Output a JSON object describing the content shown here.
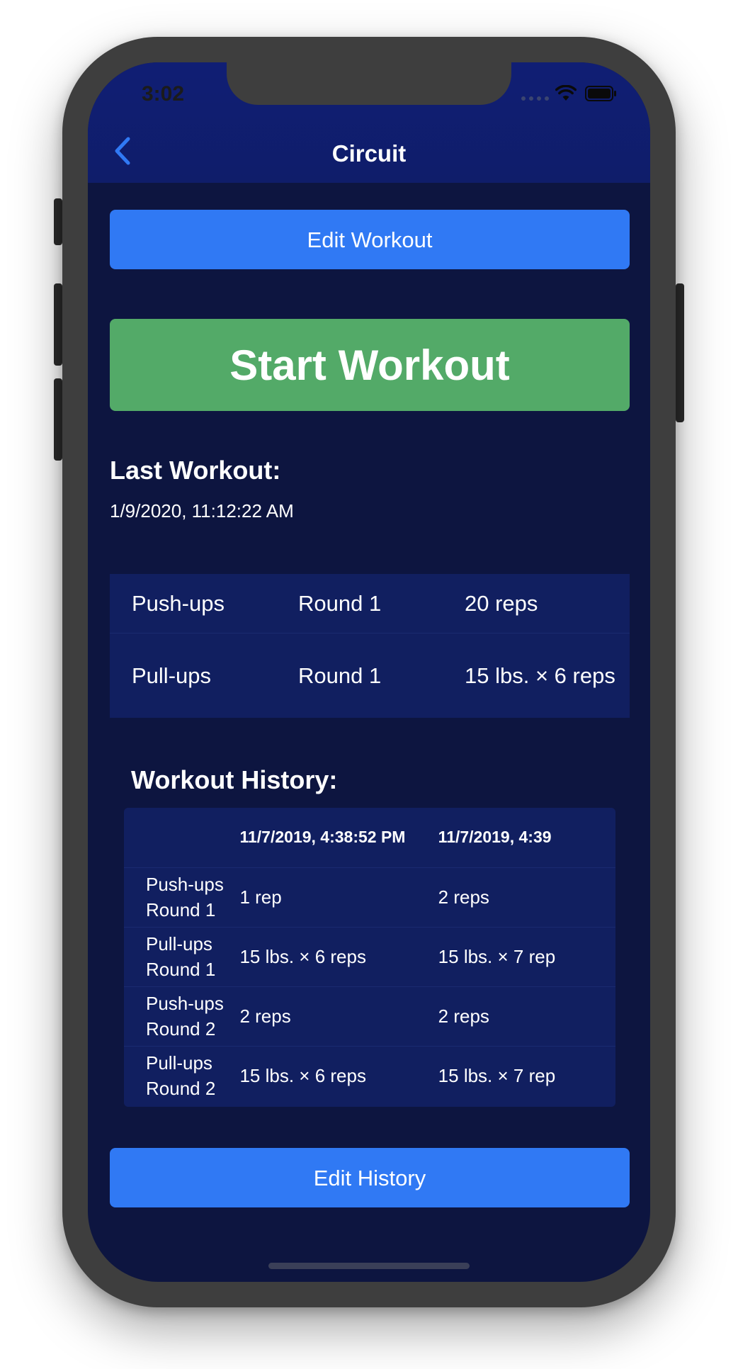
{
  "status_bar": {
    "time": "3:02"
  },
  "nav": {
    "title": "Circuit",
    "back_icon": "chevron-left-icon"
  },
  "buttons": {
    "edit_workout": "Edit Workout",
    "start_workout": "Start Workout",
    "edit_history": "Edit History"
  },
  "last_workout": {
    "heading": "Last Workout:",
    "date": "1/9/2020, 11:12:22 AM",
    "rows": [
      {
        "exercise": "Push-ups",
        "round": "Round 1",
        "result": "20 reps"
      },
      {
        "exercise": "Pull-ups",
        "round": "Round 1",
        "result": "15 lbs. × 6 reps"
      }
    ]
  },
  "history": {
    "heading": "Workout History:",
    "columns": [
      "11/7/2019, 4:38:52 PM",
      "11/7/2019, 4:39"
    ],
    "rows": [
      {
        "exercise": "Push-ups",
        "round": "Round 1",
        "values": [
          "1 rep",
          "2 reps"
        ]
      },
      {
        "exercise": "Pull-ups",
        "round": "Round 1",
        "values": [
          "15 lbs. × 6 reps",
          "15 lbs. × 7 rep"
        ]
      },
      {
        "exercise": "Push-ups",
        "round": "Round 2",
        "values": [
          "2 reps",
          "2 reps"
        ]
      },
      {
        "exercise": "Pull-ups",
        "round": "Round 2",
        "values": [
          "15 lbs. × 6 reps",
          "15 lbs. × 7 rep"
        ]
      }
    ]
  },
  "colors": {
    "screen_bg": "#0d1540",
    "navbar_bg": "#101e74",
    "table_bg": "#111f60",
    "primary_blue": "#3079f4",
    "start_green": "#53aa68",
    "back_chevron": "#3079f4"
  }
}
